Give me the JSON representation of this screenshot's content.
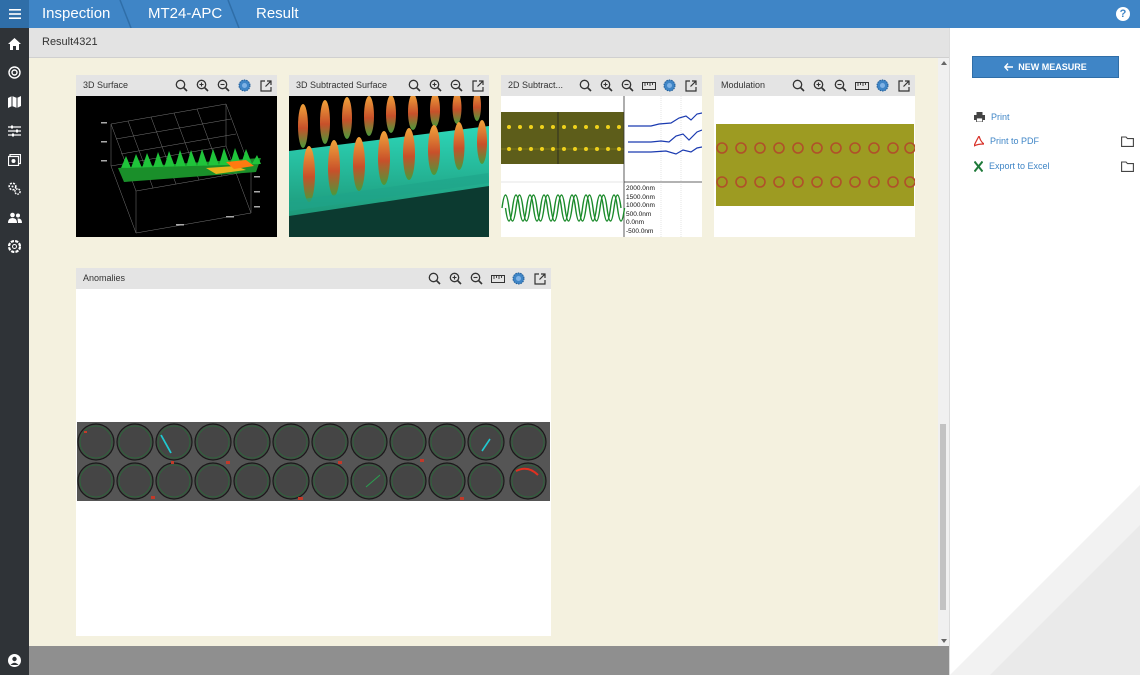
{
  "header": {
    "breadcrumbs": [
      "Inspection",
      "MT24-APC",
      "Result"
    ],
    "help_label": "?"
  },
  "result": {
    "title": "Result4321"
  },
  "panels": {
    "surface3d": {
      "title": "3D Surface"
    },
    "subtracted3d": {
      "title": "3D Subtracted Surface"
    },
    "subtracted2d": {
      "title": "2D Subtract...",
      "scale_labels": [
        "2000.0nm",
        "1500.0nm",
        "1000.0nm",
        "500.0nm",
        "0.0nm",
        "-500.0nm"
      ]
    },
    "modulation": {
      "title": "Modulation"
    },
    "anomalies": {
      "title": "Anomalies"
    }
  },
  "sidebar": {
    "new_measure_label": "NEW MEASURE",
    "actions": [
      {
        "label": "Print",
        "icon": "printer-icon"
      },
      {
        "label": "Print to PDF",
        "icon": "pdf-icon"
      },
      {
        "label": "Export to Excel",
        "icon": "excel-icon"
      }
    ]
  },
  "colors": {
    "accent": "#3f85c6",
    "rail": "#2f3337",
    "content_bg": "#f4f1df"
  }
}
